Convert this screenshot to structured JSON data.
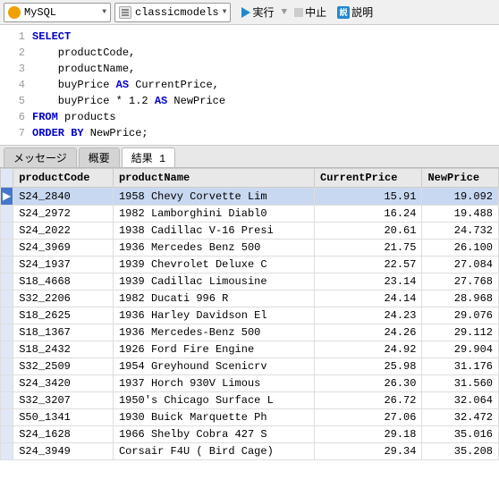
{
  "toolbar": {
    "db_label": "MySQL",
    "schema_label": "classicmodels",
    "run_label": "実行",
    "stop_label": "中止",
    "explain_label": "説明"
  },
  "editor": {
    "lines": [
      {
        "num": 1,
        "text": "SELECT",
        "tokens": [
          {
            "type": "kw",
            "val": "SELECT"
          }
        ]
      },
      {
        "num": 2,
        "text": "    productCode,",
        "indent": "    ",
        "plain": "productCode,"
      },
      {
        "num": 3,
        "text": "    productName,",
        "indent": "    ",
        "plain": "productName,"
      },
      {
        "num": 4,
        "text": "    buyPrice AS CurrentPrice,",
        "indent": "    ",
        "kw": "AS",
        "parts": [
          "buyPrice ",
          "AS",
          " CurrentPrice,"
        ]
      },
      {
        "num": 5,
        "text": "    buyPrice * 1.2 AS NewPrice",
        "indent": "    ",
        "plain": "buyPrice * 1.2 AS NewPrice"
      },
      {
        "num": 6,
        "text": "FROM products",
        "kw": "FROM",
        "plain": " products"
      },
      {
        "num": 7,
        "text": "ORDER BY NewPrice;",
        "kw": "ORDER BY",
        "plain": " NewPrice;"
      }
    ]
  },
  "tabs": [
    {
      "label": "メッセージ",
      "active": false
    },
    {
      "label": "概要",
      "active": false
    },
    {
      "label": "結果 1",
      "active": true
    }
  ],
  "table": {
    "columns": [
      "productCode",
      "productName",
      "CurrentPrice",
      "NewPrice"
    ],
    "rows": [
      {
        "selected": true,
        "code": "S24_2840",
        "name": "1958 Chevy Corvette Lim",
        "cp": "15.91",
        "np": "19.092"
      },
      {
        "selected": false,
        "code": "S24_2972",
        "name": "1982 Lamborghini Diabl0",
        "cp": "16.24",
        "np": "19.488"
      },
      {
        "selected": false,
        "code": "S24_2022",
        "name": "1938 Cadillac V-16 Presi",
        "cp": "20.61",
        "np": "24.732"
      },
      {
        "selected": false,
        "code": "S24_3969",
        "name": "1936 Mercedes Benz 500",
        "cp": "21.75",
        "np": "26.100"
      },
      {
        "selected": false,
        "code": "S24_1937",
        "name": "1939 Chevrolet Deluxe C",
        "cp": "22.57",
        "np": "27.084"
      },
      {
        "selected": false,
        "code": "S18_4668",
        "name": "1939 Cadillac Limousine",
        "cp": "23.14",
        "np": "27.768"
      },
      {
        "selected": false,
        "code": "S32_2206",
        "name": "1982 Ducati 996 R",
        "cp": "24.14",
        "np": "28.968"
      },
      {
        "selected": false,
        "code": "S18_2625",
        "name": "1936 Harley Davidson El",
        "cp": "24.23",
        "np": "29.076"
      },
      {
        "selected": false,
        "code": "S18_1367",
        "name": "1936 Mercedes-Benz 500",
        "cp": "24.26",
        "np": "29.112"
      },
      {
        "selected": false,
        "code": "S18_2432",
        "name": "1926 Ford Fire Engine",
        "cp": "24.92",
        "np": "29.904"
      },
      {
        "selected": false,
        "code": "S32_2509",
        "name": "1954 Greyhound Scenicrv",
        "cp": "25.98",
        "np": "31.176"
      },
      {
        "selected": false,
        "code": "S24_3420",
        "name": "1937 Horch 930V Limous",
        "cp": "26.30",
        "np": "31.560"
      },
      {
        "selected": false,
        "code": "S32_3207",
        "name": "1950's Chicago Surface L",
        "cp": "26.72",
        "np": "32.064"
      },
      {
        "selected": false,
        "code": "S50_1341",
        "name": "1930 Buick Marquette Ph",
        "cp": "27.06",
        "np": "32.472"
      },
      {
        "selected": false,
        "code": "S24_1628",
        "name": "1966 Shelby Cobra 427 S",
        "cp": "29.18",
        "np": "35.016"
      },
      {
        "selected": false,
        "code": "S24_3949",
        "name": "Corsair F4U ( Bird Cage)",
        "cp": "29.34",
        "np": "35.208"
      }
    ]
  }
}
